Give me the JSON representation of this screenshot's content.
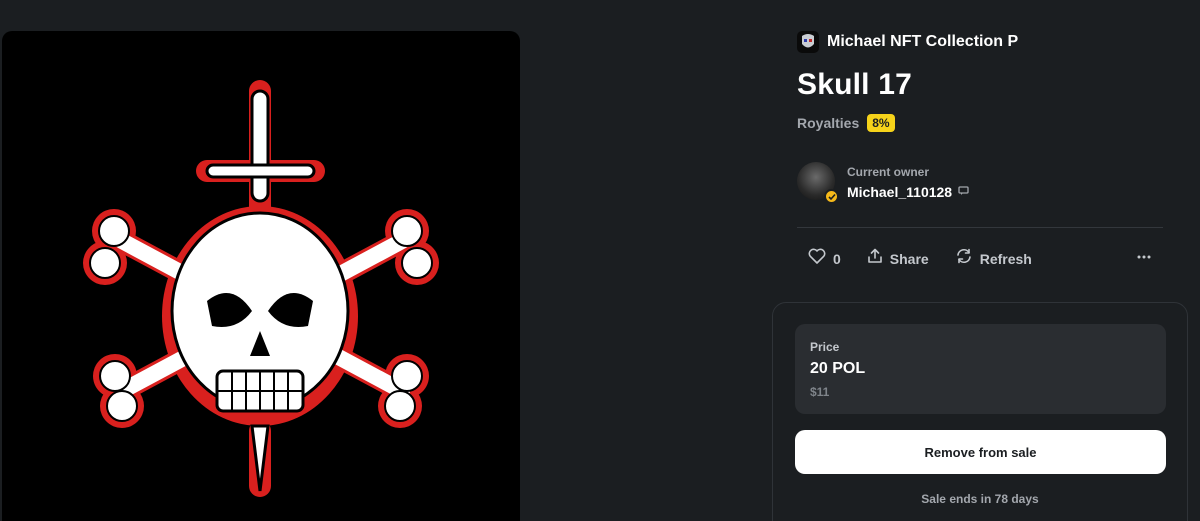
{
  "collection": {
    "name": "Michael NFT Collection P",
    "avatar_icon": "skull-mask-icon"
  },
  "item": {
    "title": "Skull 17",
    "royalties_label": "Royalties",
    "royalties_value": "8%"
  },
  "owner": {
    "label": "Current owner",
    "name": "Michael_110128",
    "verified_icon": "verified-check-icon",
    "chat_icon": "message-icon"
  },
  "actions": {
    "like": {
      "icon": "heart-icon",
      "count": "0"
    },
    "share": {
      "icon": "share-icon",
      "label": "Share"
    },
    "refresh": {
      "icon": "refresh-icon",
      "label": "Refresh"
    },
    "more": {
      "icon": "more-dots-icon"
    }
  },
  "sale": {
    "price_label": "Price",
    "price_value": "20 POL",
    "price_usd": "$11",
    "remove_label": "Remove from sale",
    "ends_text": "Sale ends in 78 days"
  },
  "colors": {
    "background": "#1b1e21",
    "accent_badge": "#f6d31a",
    "artwork_red": "#d9201e"
  }
}
